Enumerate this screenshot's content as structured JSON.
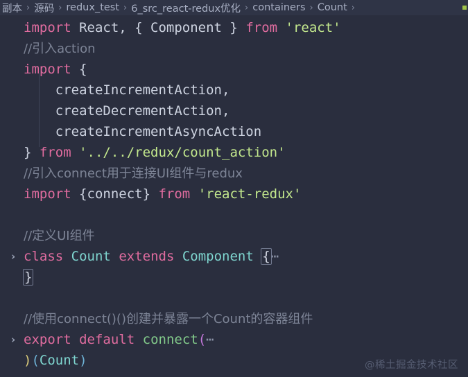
{
  "breadcrumb": {
    "separator": "›",
    "items": [
      {
        "label": "副本"
      },
      {
        "label": "源码"
      },
      {
        "label": "redux_test"
      },
      {
        "label": "6_src_react-redux优化"
      },
      {
        "label": "containers"
      },
      {
        "label": "Count"
      }
    ],
    "end_marker_color": "#9fc34a"
  },
  "editor": {
    "background": "#2a2e3e",
    "breadcrumb_background": "#2f3446",
    "fold_chevron": "›",
    "fold_placeholder": "⋯",
    "colors": {
      "keyword": "#e06c9f",
      "string": "#c3e88d",
      "comment": "#7d8496",
      "type": "#7fd6d0",
      "function": "#82c98a",
      "plain": "#cdd3e0",
      "bracket_yellow": "#d8c97a",
      "bracket_blue": "#6fb4d8"
    },
    "lines": [
      {
        "folded": false,
        "tokens": [
          {
            "t": "import",
            "c": "kw"
          },
          {
            "t": " React, { Component } ",
            "c": "plain"
          },
          {
            "t": "from",
            "c": "kw"
          },
          {
            "t": " ",
            "c": "plain"
          },
          {
            "t": "'react'",
            "c": "str"
          }
        ]
      },
      {
        "folded": false,
        "tokens": [
          {
            "t": "//引入action",
            "c": "cmt"
          }
        ]
      },
      {
        "folded": false,
        "tokens": [
          {
            "t": "import",
            "c": "kw"
          },
          {
            "t": " {",
            "c": "plain"
          }
        ]
      },
      {
        "folded": false,
        "tokens": [
          {
            "t": "    createIncrementAction,",
            "c": "plain"
          }
        ]
      },
      {
        "folded": false,
        "tokens": [
          {
            "t": "    createDecrementAction,",
            "c": "plain"
          }
        ]
      },
      {
        "folded": false,
        "tokens": [
          {
            "t": "    createIncrementAsyncAction",
            "c": "plain"
          }
        ]
      },
      {
        "folded": false,
        "tokens": [
          {
            "t": "} ",
            "c": "plain"
          },
          {
            "t": "from",
            "c": "kw"
          },
          {
            "t": " ",
            "c": "plain"
          },
          {
            "t": "'../../redux/count_action'",
            "c": "str"
          }
        ]
      },
      {
        "folded": false,
        "tokens": [
          {
            "t": "//引入connect用于连接UI组件与redux",
            "c": "cmt"
          }
        ]
      },
      {
        "folded": false,
        "tokens": [
          {
            "t": "import",
            "c": "kw"
          },
          {
            "t": " {connect} ",
            "c": "plain"
          },
          {
            "t": "from",
            "c": "kw"
          },
          {
            "t": " ",
            "c": "plain"
          },
          {
            "t": "'react-redux'",
            "c": "str"
          }
        ]
      },
      {
        "folded": false,
        "tokens": []
      },
      {
        "folded": false,
        "tokens": [
          {
            "t": "//定义UI组件",
            "c": "cmt"
          }
        ]
      },
      {
        "folded": true,
        "tokens": [
          {
            "t": "class",
            "c": "kw"
          },
          {
            "t": " ",
            "c": "plain"
          },
          {
            "t": "Count",
            "c": "type"
          },
          {
            "t": " ",
            "c": "plain"
          },
          {
            "t": "extends",
            "c": "kw"
          },
          {
            "t": " ",
            "c": "plain"
          },
          {
            "t": "Component",
            "c": "type"
          },
          {
            "t": " ",
            "c": "plain"
          },
          {
            "t": "{",
            "c": "br1 bracket-box"
          },
          {
            "t": "⋯",
            "c": "ellipsis"
          }
        ]
      },
      {
        "folded": false,
        "tokens": [
          {
            "t": "}",
            "c": "br1 bracket-box"
          }
        ]
      },
      {
        "folded": false,
        "tokens": []
      },
      {
        "folded": false,
        "tokens": [
          {
            "t": "//使用connect()()创建并暴露一个Count的容器组件",
            "c": "cmt"
          }
        ]
      },
      {
        "folded": true,
        "tokens": [
          {
            "t": "export",
            "c": "kw"
          },
          {
            "t": " ",
            "c": "plain"
          },
          {
            "t": "default",
            "c": "kw"
          },
          {
            "t": " ",
            "c": "plain"
          },
          {
            "t": "connect",
            "c": "fn"
          },
          {
            "t": "(",
            "c": "br-p"
          },
          {
            "t": "⋯",
            "c": "ellipsis"
          }
        ]
      },
      {
        "folded": false,
        "tokens": [
          {
            "t": ")",
            "c": "br-y"
          },
          {
            "t": "(",
            "c": "br-b"
          },
          {
            "t": "Count",
            "c": "type"
          },
          {
            "t": ")",
            "c": "br-b"
          }
        ]
      }
    ]
  },
  "watermark": {
    "text": "@稀土掘金技术社区"
  }
}
